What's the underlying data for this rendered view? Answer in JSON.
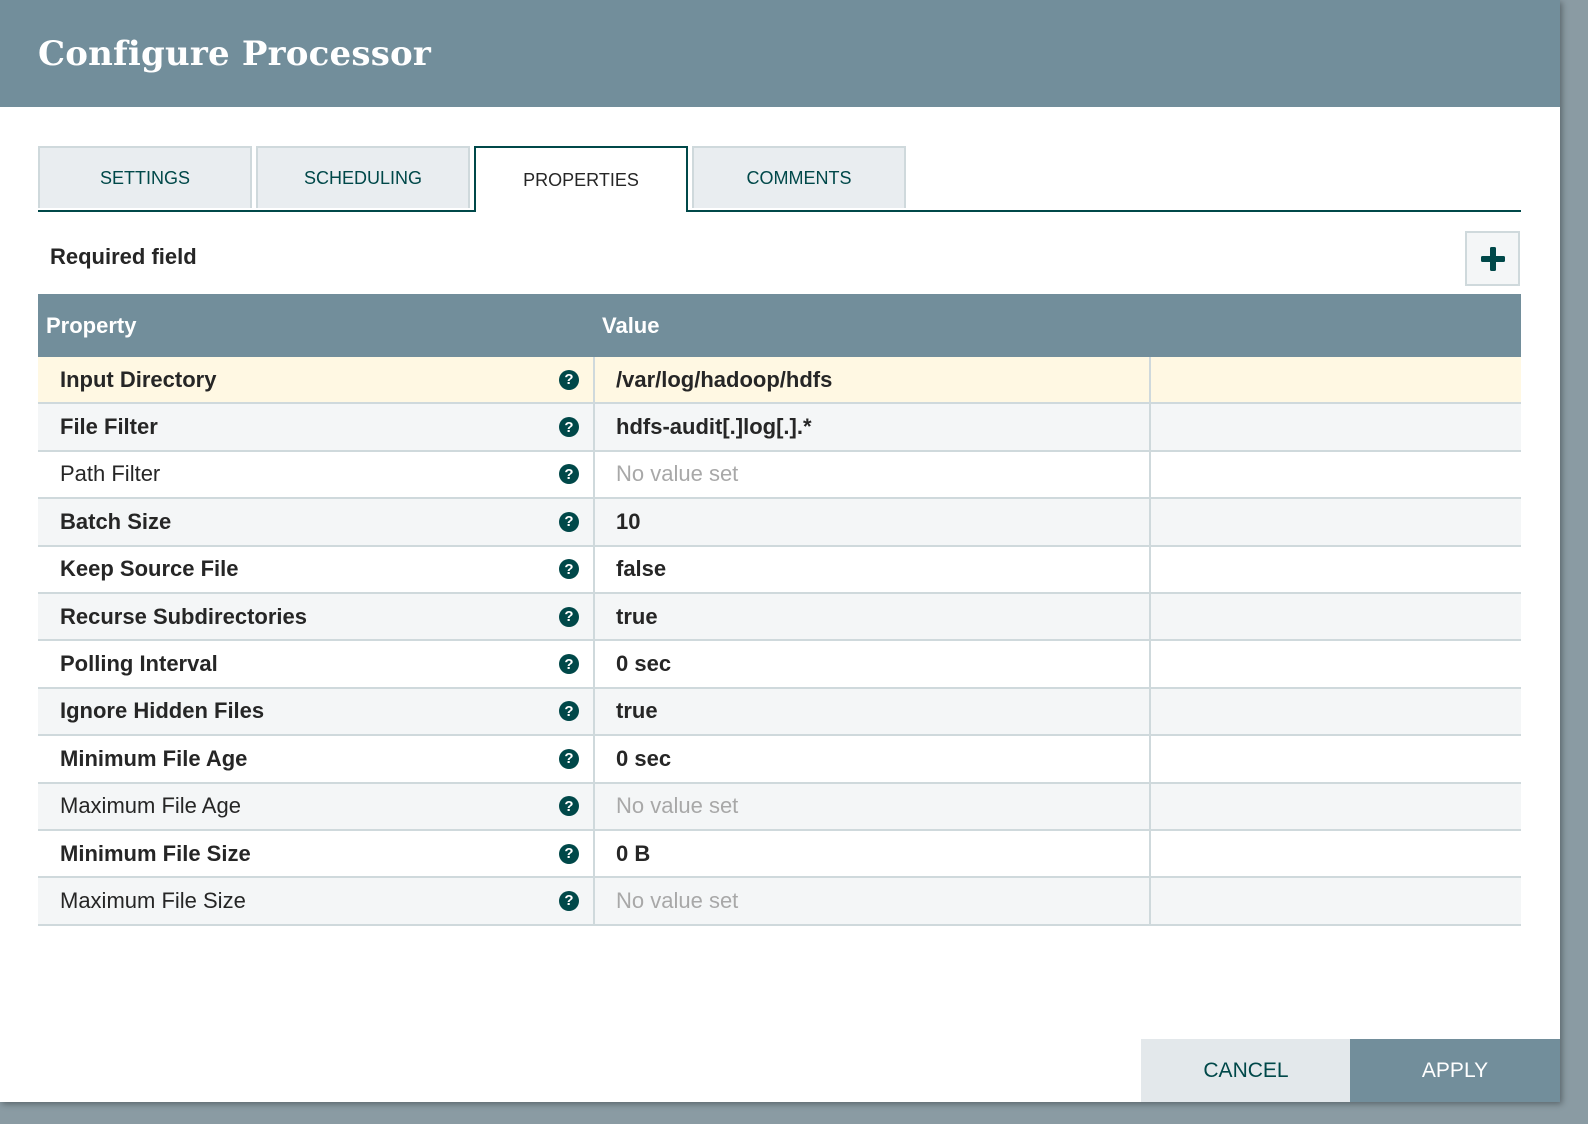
{
  "dialog": {
    "title": "Configure Processor"
  },
  "tabs": [
    {
      "label": "SETTINGS",
      "active": false
    },
    {
      "label": "SCHEDULING",
      "active": false
    },
    {
      "label": "PROPERTIES",
      "active": true
    },
    {
      "label": "COMMENTS",
      "active": false
    }
  ],
  "properties_panel": {
    "required_label": "Required field",
    "add_icon": "plus-icon",
    "columns": {
      "property": "Property",
      "value": "Value"
    },
    "help_icon": "question-circle-icon",
    "rows": [
      {
        "name": "Input Directory",
        "value": "/var/log/hadoop/hdfs",
        "required": true,
        "empty": false,
        "selected": true
      },
      {
        "name": "File Filter",
        "value": "hdfs-audit[.]log[.].*",
        "required": true,
        "empty": false,
        "selected": false
      },
      {
        "name": "Path Filter",
        "value": "No value set",
        "required": false,
        "empty": true,
        "selected": false
      },
      {
        "name": "Batch Size",
        "value": "10",
        "required": true,
        "empty": false,
        "selected": false
      },
      {
        "name": "Keep Source File",
        "value": "false",
        "required": true,
        "empty": false,
        "selected": false
      },
      {
        "name": "Recurse Subdirectories",
        "value": "true",
        "required": true,
        "empty": false,
        "selected": false
      },
      {
        "name": "Polling Interval",
        "value": "0 sec",
        "required": true,
        "empty": false,
        "selected": false
      },
      {
        "name": "Ignore Hidden Files",
        "value": "true",
        "required": true,
        "empty": false,
        "selected": false
      },
      {
        "name": "Minimum File Age",
        "value": "0 sec",
        "required": true,
        "empty": false,
        "selected": false
      },
      {
        "name": "Maximum File Age",
        "value": "No value set",
        "required": false,
        "empty": true,
        "selected": false
      },
      {
        "name": "Minimum File Size",
        "value": "0 B",
        "required": true,
        "empty": false,
        "selected": false
      },
      {
        "name": "Maximum File Size",
        "value": "No value set",
        "required": false,
        "empty": true,
        "selected": false
      }
    ]
  },
  "footer": {
    "cancel_label": "CANCEL",
    "apply_label": "APPLY"
  },
  "colors": {
    "header_bg": "#728e9b",
    "accent": "#004849",
    "selected_row": "#fff8e3"
  }
}
